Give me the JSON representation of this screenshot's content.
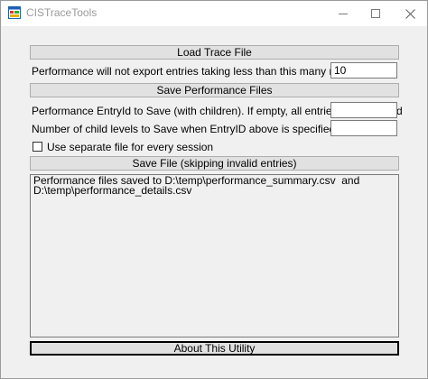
{
  "window": {
    "title": "CISTraceTools",
    "icon": "app-window-icon"
  },
  "buttons": {
    "load_trace": "Load Trace File",
    "save_performance": "Save Performance Files",
    "save_file": "Save File (skipping invalid entries)",
    "about": "About This Utility"
  },
  "labels": {
    "min_ms": "Performance will not export entries taking less than this many milliseconds",
    "entry_id": "Performance EntryId to Save (with children).  If empty, all entries will be saved",
    "child_levels": "Number of child levels to Save when EntryID above is specified",
    "separate_file": "Use separate file for every session"
  },
  "inputs": {
    "min_ms_value": "10",
    "entry_id_value": "",
    "child_levels_value": ""
  },
  "checkbox": {
    "separate_file_checked": false
  },
  "output": {
    "text": "Performance files saved to D:\\temp\\performance_summary.csv  and\nD:\\temp\\performance_details.csv"
  }
}
